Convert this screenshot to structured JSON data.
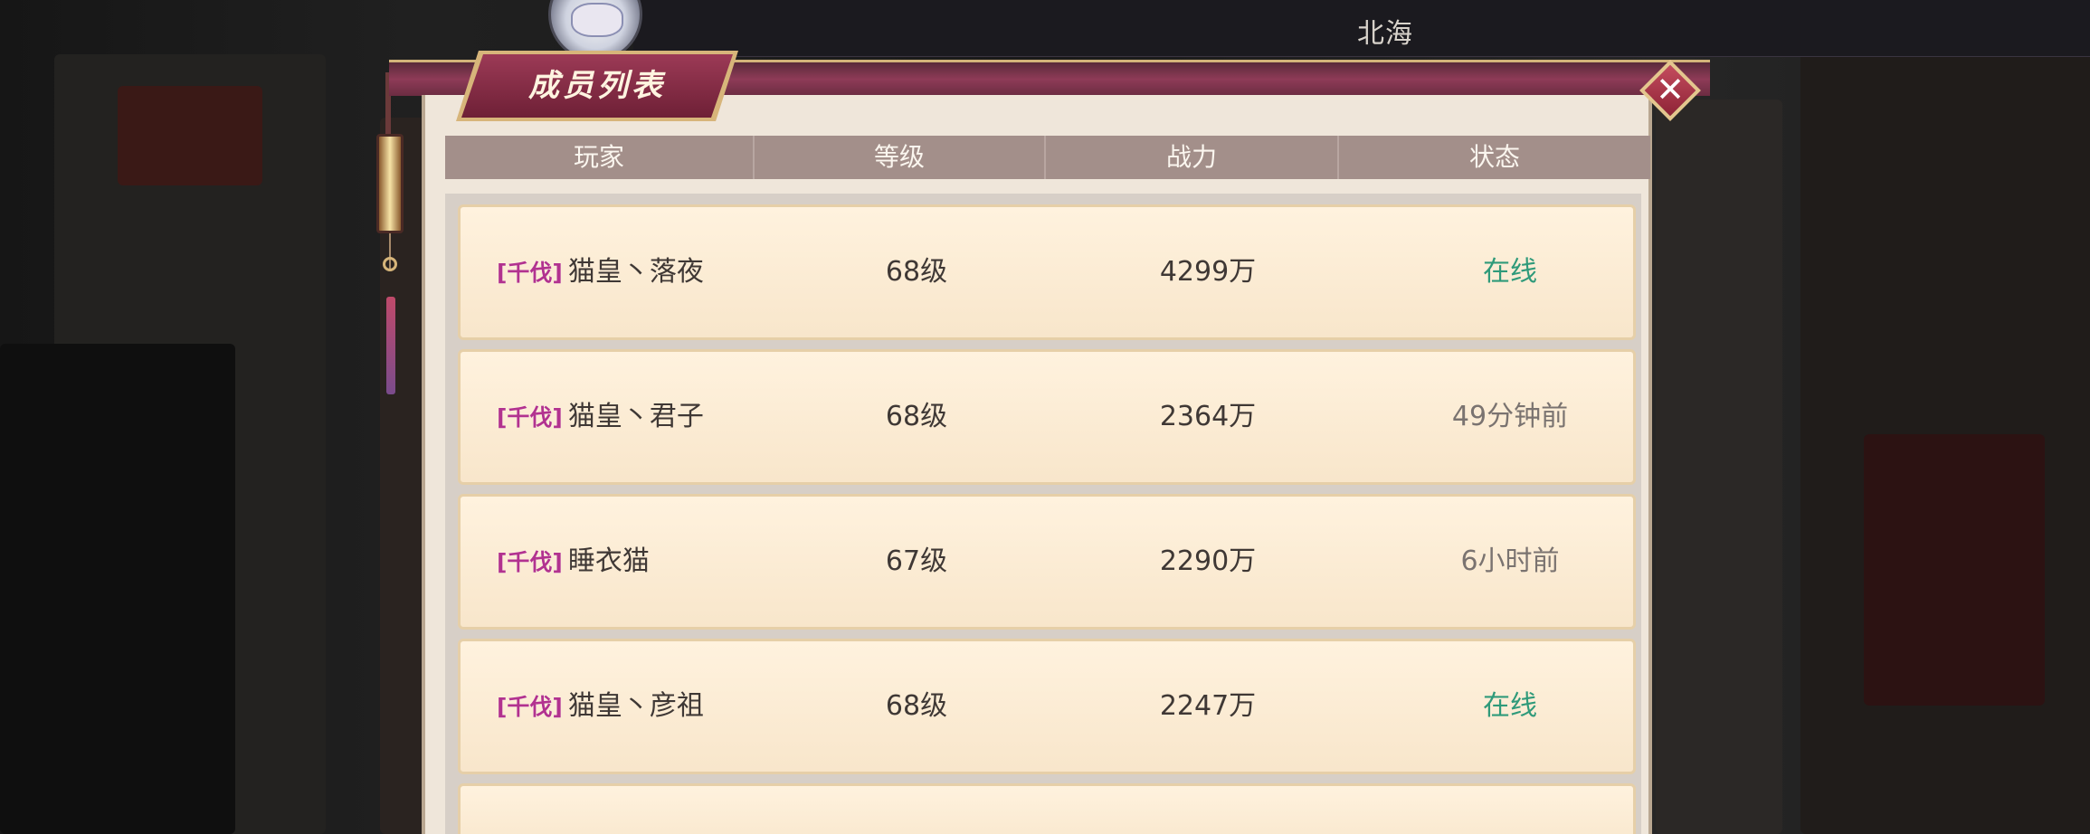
{
  "top_bar": {
    "server_name": "北海"
  },
  "dialog": {
    "title": "成员列表",
    "close_icon": "close-icon",
    "columns": [
      "玩家",
      "等级",
      "战力",
      "状态"
    ]
  },
  "members": [
    {
      "tag": "[千伐]",
      "name": "猫皇丶落夜",
      "level": "68级",
      "power": "4299万",
      "status": "在线",
      "online": true
    },
    {
      "tag": "[千伐]",
      "name": "猫皇丶君子",
      "level": "68级",
      "power": "2364万",
      "status": "49分钟前",
      "online": false
    },
    {
      "tag": "[千伐]",
      "name": "睡衣猫",
      "level": "67级",
      "power": "2290万",
      "status": "6小时前",
      "online": false
    },
    {
      "tag": "[千伐]",
      "name": "猫皇丶彦祖",
      "level": "68级",
      "power": "2247万",
      "status": "在线",
      "online": true
    }
  ],
  "colors": {
    "online": "#2f9a7a",
    "offline": "#7a7370",
    "guild_tag": "#b2328f",
    "header": "#a38f8a",
    "title_plaque": "#8e3b57"
  }
}
